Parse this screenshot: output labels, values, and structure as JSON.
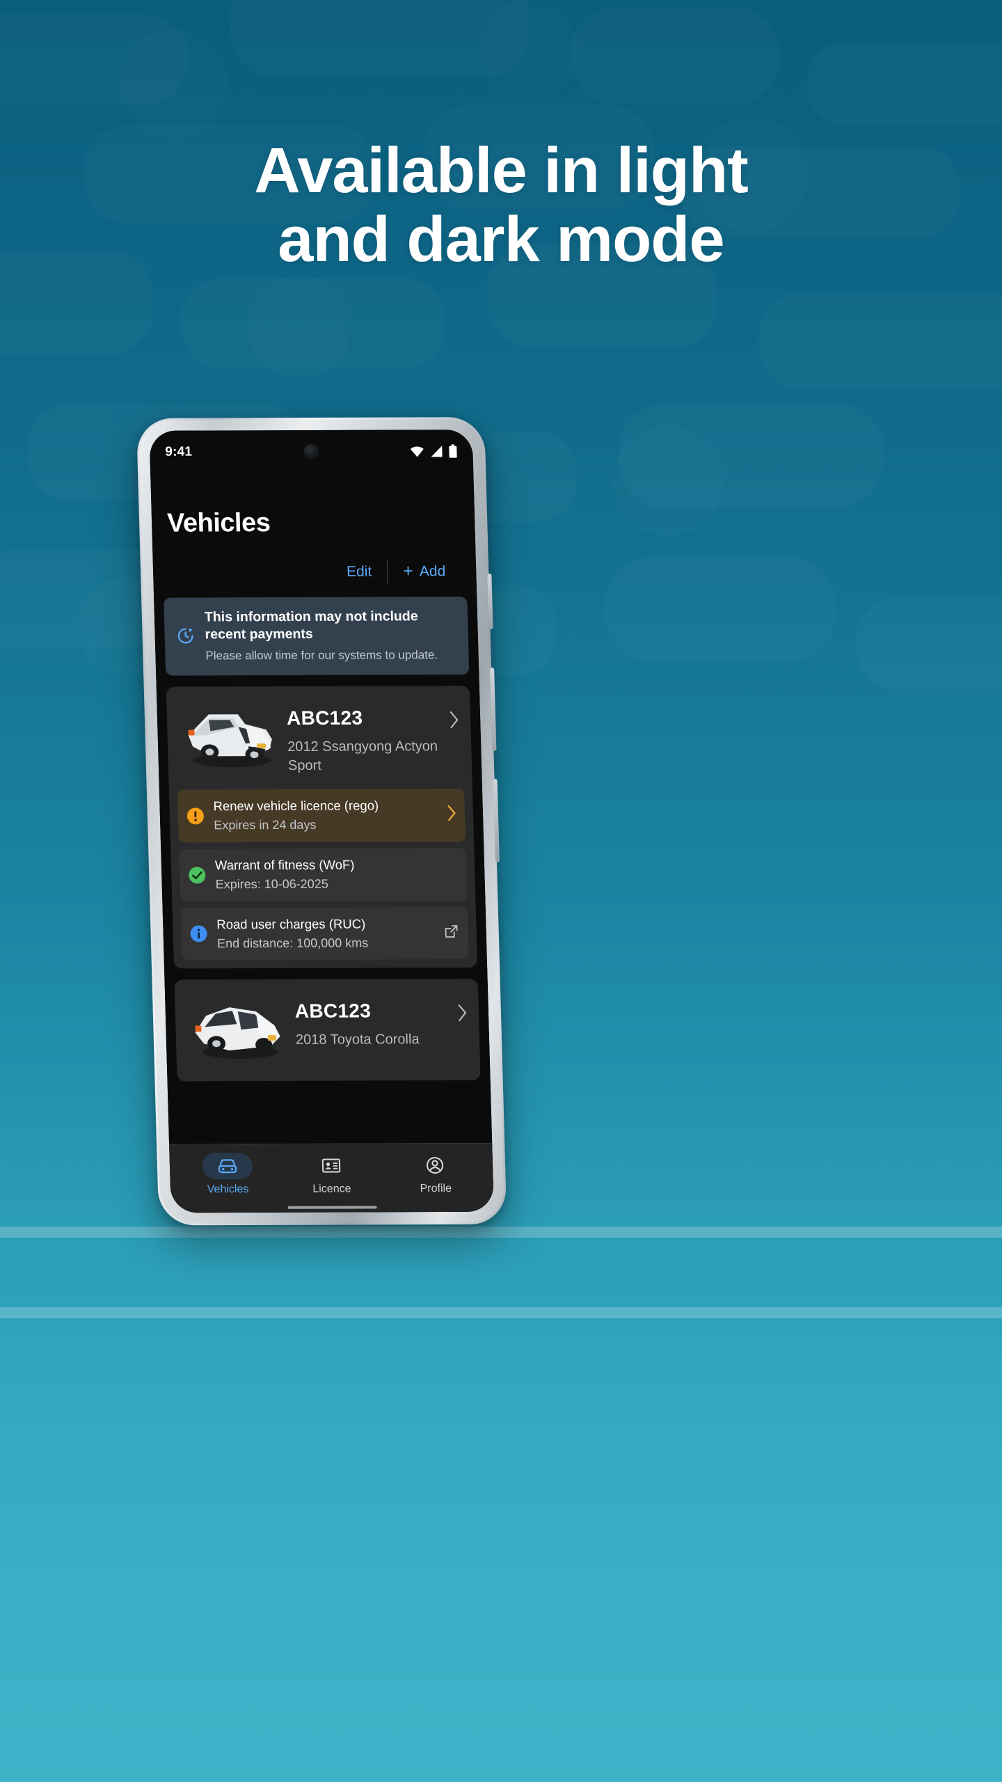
{
  "promo": {
    "headline_line1": "Available in light",
    "headline_line2": "and dark mode",
    "bg_color_top": "#0a5d7c",
    "bg_color_bottom": "#3eb3c8"
  },
  "status_bar": {
    "time": "9:41",
    "icons": [
      "wifi-icon",
      "cellular-signal-icon",
      "battery-icon"
    ]
  },
  "app": {
    "page_title": "Vehicles",
    "accent_color": "#5aa9f8",
    "actions": {
      "edit_label": "Edit",
      "add_label": "Add",
      "add_plus": "+"
    },
    "banner": {
      "icon": "refresh-clock-icon",
      "title": "This information may not include recent payments",
      "subtitle": "Please allow time for our systems to update.",
      "background": "#33414f"
    },
    "vehicles": [
      {
        "plate": "ABC123",
        "description": "2012 Ssangyong Actyon Sport",
        "image": "white-pickup-truck-image",
        "chevron": "chevron-right-icon",
        "statuses": [
          {
            "id": "rego",
            "state": "warning",
            "icon": "warning-exclamation-icon",
            "icon_color": "#f59e18",
            "background": "#463a26",
            "title": "Renew vehicle licence (rego)",
            "subtitle": "Expires in 24 days",
            "end_icon": "chevron-right-icon",
            "end_icon_color": "#f0a93a"
          },
          {
            "id": "wof",
            "state": "ok",
            "icon": "check-circle-icon",
            "icon_color": "#4cc25f",
            "background": "#343434",
            "title": "Warrant of fitness (WoF)",
            "subtitle": "Expires: 10-06-2025",
            "end_icon": "",
            "end_icon_color": ""
          },
          {
            "id": "ruc",
            "state": "info",
            "icon": "info-circle-icon",
            "icon_color": "#3d8ef0",
            "background": "#343434",
            "title": "Road user charges (RUC)",
            "subtitle": "End distance: 100,000 kms",
            "end_icon": "external-link-icon",
            "end_icon_color": "#b9bcbf"
          }
        ]
      },
      {
        "plate": "ABC123",
        "description": "2018 Toyota Corolla",
        "image": "white-hatchback-car-image",
        "chevron": "chevron-right-icon",
        "statuses": []
      }
    ],
    "bottom_nav": {
      "items": [
        {
          "id": "vehicles",
          "label": "Vehicles",
          "icon": "car-icon",
          "active": true
        },
        {
          "id": "licence",
          "label": "Licence",
          "icon": "id-card-icon",
          "active": false
        },
        {
          "id": "profile",
          "label": "Profile",
          "icon": "person-circle-icon",
          "active": false
        }
      ]
    }
  }
}
